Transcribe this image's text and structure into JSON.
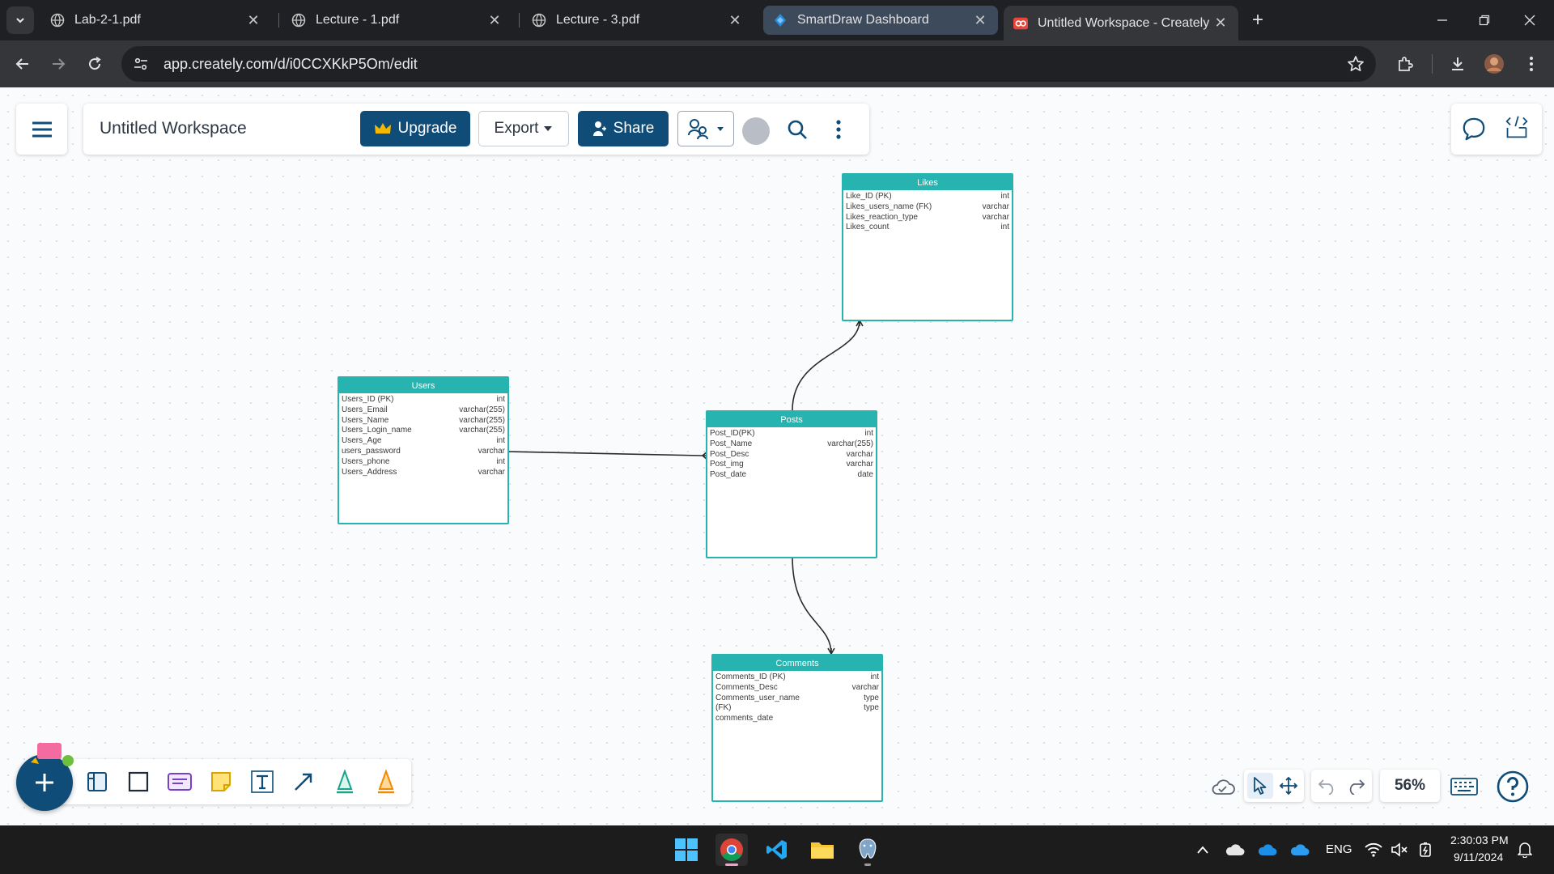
{
  "browser": {
    "tabs": [
      {
        "title": "Lab-2-1.pdf"
      },
      {
        "title": "Lecture - 1.pdf"
      },
      {
        "title": "Lecture - 3.pdf"
      },
      {
        "title": "SmartDraw Dashboard"
      },
      {
        "title": "Untitled Workspace - Creately"
      }
    ],
    "url": "app.creately.com/d/i0CCXKkP5Om/edit"
  },
  "workspace": {
    "title": "Untitled Workspace",
    "upgrade_label": "Upgrade",
    "export_label": "Export",
    "share_label": "Share"
  },
  "entities": {
    "likes": {
      "name": "Likes",
      "rows": [
        {
          "field": "Like_ID (PK)",
          "type": "int"
        },
        {
          "field": "Likes_users_name (FK)",
          "type": "varchar"
        },
        {
          "field": "Likes_reaction_type",
          "type": "varchar"
        },
        {
          "field": "Likes_count",
          "type": "int"
        }
      ]
    },
    "users": {
      "name": "Users",
      "rows": [
        {
          "field": "Users_ID (PK)",
          "type": "int"
        },
        {
          "field": "Users_Email",
          "type": "varchar(255)"
        },
        {
          "field": "Users_Name",
          "type": "varchar(255)"
        },
        {
          "field": "Users_Login_name",
          "type": "varchar(255)"
        },
        {
          "field": "Users_Age",
          "type": "int"
        },
        {
          "field": "users_password",
          "type": "varchar"
        },
        {
          "field": "Users_phone",
          "type": "int"
        },
        {
          "field": "Users_Address",
          "type": "varchar"
        }
      ]
    },
    "posts": {
      "name": "Posts",
      "rows": [
        {
          "field": "Post_ID(PK)",
          "type": "int"
        },
        {
          "field": "Post_Name",
          "type": "varchar(255)"
        },
        {
          "field": "Post_Desc",
          "type": "varchar"
        },
        {
          "field": "Post_img",
          "type": "varchar"
        },
        {
          "field": "Post_date",
          "type": "date"
        }
      ]
    },
    "comments": {
      "name": "Comments",
      "rows": [
        {
          "field": "Comments_ID (PK)",
          "type": "int"
        },
        {
          "field": "Comments_Desc",
          "type": "varchar"
        },
        {
          "field": "Comments_user_name",
          "type": "type"
        },
        {
          "field": "(FK)",
          "type": "type"
        },
        {
          "field": "comments_date",
          "type": ""
        }
      ]
    }
  },
  "canvas_controls": {
    "zoom": "56%"
  },
  "taskbar": {
    "lang": "ENG",
    "time": "2:30:03 PM",
    "date": "9/11/2024"
  },
  "colors": {
    "brand": "#0f4c78",
    "entity": "#27b3b0"
  },
  "icons": [
    "menu-icon",
    "crown-icon",
    "chevron-down-icon",
    "share-person-icon",
    "collaborators-icon",
    "search-icon",
    "more-vertical-icon",
    "comment-icon",
    "embed-icon",
    "plus-icon",
    "template-icon",
    "rectangle-icon",
    "card-icon",
    "sticky-note-icon",
    "text-icon",
    "arrow-icon",
    "pen-icon",
    "highlighter-icon",
    "cloud-icon",
    "pointer-icon",
    "move-icon",
    "undo-icon",
    "redo-icon",
    "keyboard-icon",
    "help-icon"
  ]
}
